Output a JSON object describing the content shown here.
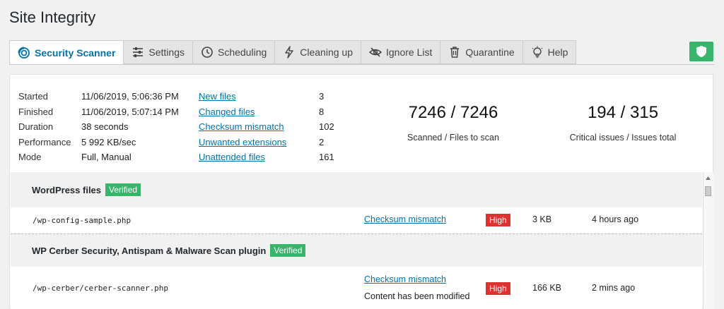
{
  "page_title": "Site Integrity",
  "tabs": [
    {
      "label": "Security Scanner",
      "icon": "scanner-icon",
      "active": true
    },
    {
      "label": "Settings",
      "icon": "sliders-icon"
    },
    {
      "label": "Scheduling",
      "icon": "clock-icon"
    },
    {
      "label": "Cleaning up",
      "icon": "lightning-icon"
    },
    {
      "label": "Ignore List",
      "icon": "eye-off-icon"
    },
    {
      "label": "Quarantine",
      "icon": "trash-icon"
    },
    {
      "label": "Help",
      "icon": "lightbulb-icon"
    }
  ],
  "status_icon": "shield-icon",
  "colors": {
    "accent": "#0073aa",
    "verified": "#37b66b",
    "high": "#dc3232"
  },
  "summary": {
    "started_label": "Started",
    "started_value": "11/06/2019, 5:06:36 PM",
    "finished_label": "Finished",
    "finished_value": "11/06/2019, 5:07:14 PM",
    "duration_label": "Duration",
    "duration_value": "38 seconds",
    "performance_label": "Performance",
    "performance_value": "5 992 KB/sec",
    "mode_label": "Mode",
    "mode_value": "Full, Manual",
    "links": [
      {
        "label": "New files",
        "count": "3"
      },
      {
        "label": "Changed files",
        "count": "8"
      },
      {
        "label": "Checksum mismatch",
        "count": "102"
      },
      {
        "label": "Unwanted extensions",
        "count": "2"
      },
      {
        "label": "Unattended files",
        "count": "161"
      }
    ],
    "scanned_value": "7246 / 7246",
    "scanned_caption": "Scanned / Files to scan",
    "issues_value": "194 / 315",
    "issues_caption": "Critical issues / Issues total"
  },
  "sections": [
    {
      "title": "WordPress files",
      "badge": "Verified",
      "rows": [
        {
          "file": "/wp-config-sample.php",
          "issue": "Checksum mismatch",
          "note": "",
          "severity": "High",
          "size": "3 KB",
          "time": "4 hours ago"
        }
      ]
    },
    {
      "title": "WP Cerber Security, Antispam & Malware Scan plugin",
      "badge": "Verified",
      "rows": [
        {
          "file": "/wp-cerber/cerber-scanner.php",
          "issue": "Checksum mismatch",
          "note": "Content has been modified",
          "severity": "High",
          "size": "166 KB",
          "time": "2 mins ago"
        }
      ]
    }
  ]
}
